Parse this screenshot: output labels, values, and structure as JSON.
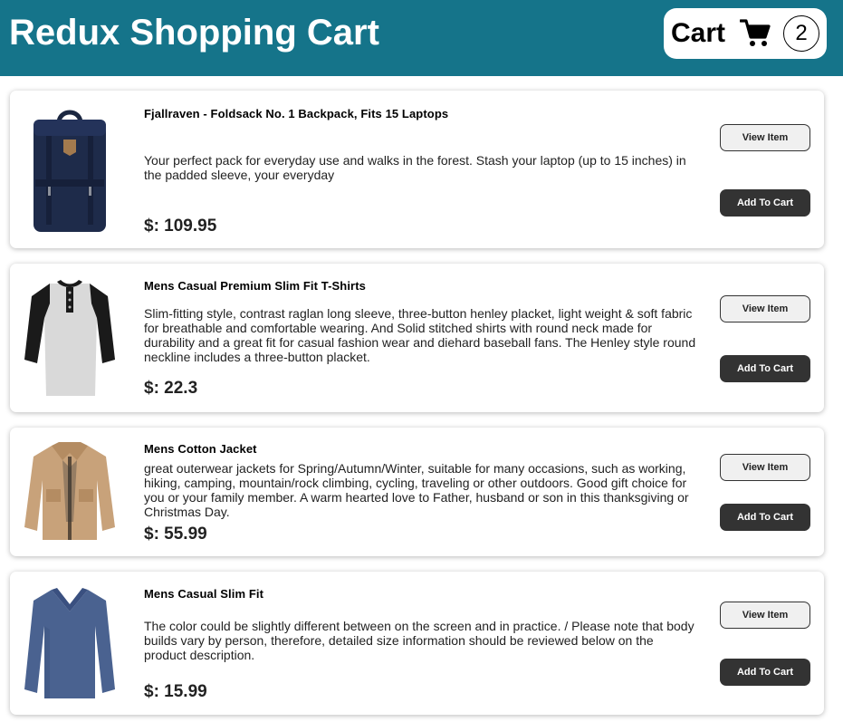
{
  "header": {
    "title": "Redux Shopping Cart",
    "cart_label": "Cart",
    "cart_count": "2",
    "cart_icon": "shopping-cart-icon"
  },
  "colors": {
    "header_bg": "#15748a",
    "button_dark": "#333333",
    "button_light": "#f0f0f0"
  },
  "products": [
    {
      "title": "Fjallraven - Foldsack No. 1 Backpack, Fits 15 Laptops",
      "description": "Your perfect pack for everyday use and walks in the forest. Stash your laptop (up to 15 inches) in the padded sleeve, your everyday",
      "price": "$: 109.95",
      "view_label": "View Item",
      "add_label": "Add To Cart",
      "image": "backpack-image"
    },
    {
      "title": "Mens Casual Premium Slim Fit T-Shirts",
      "description": "Slim-fitting style, contrast raglan long sleeve, three-button henley placket, light weight & soft fabric for breathable and comfortable wearing. And Solid stitched shirts with round neck made for durability and a great fit for casual fashion wear and diehard baseball fans. The Henley style round neckline includes a three-button placket.",
      "price": "$: 22.3",
      "view_label": "View Item",
      "add_label": "Add To Cart",
      "image": "tshirt-image"
    },
    {
      "title": "Mens Cotton Jacket",
      "description": "great outerwear jackets for Spring/Autumn/Winter, suitable for many occasions, such as working, hiking, camping, mountain/rock climbing, cycling, traveling or other outdoors. Good gift choice for you or your family member. A warm hearted love to Father, husband or son in this thanksgiving or Christmas Day.",
      "price": "$: 55.99",
      "view_label": "View Item",
      "add_label": "Add To Cart",
      "image": "jacket-image"
    },
    {
      "title": "Mens Casual Slim Fit",
      "description": "The color could be slightly different between on the screen and in practice. / Please note that body builds vary by person, therefore, detailed size information should be reviewed below on the product description.",
      "price": "$: 15.99",
      "view_label": "View Item",
      "add_label": "Add To Cart",
      "image": "longsleeve-shirt-image"
    }
  ]
}
